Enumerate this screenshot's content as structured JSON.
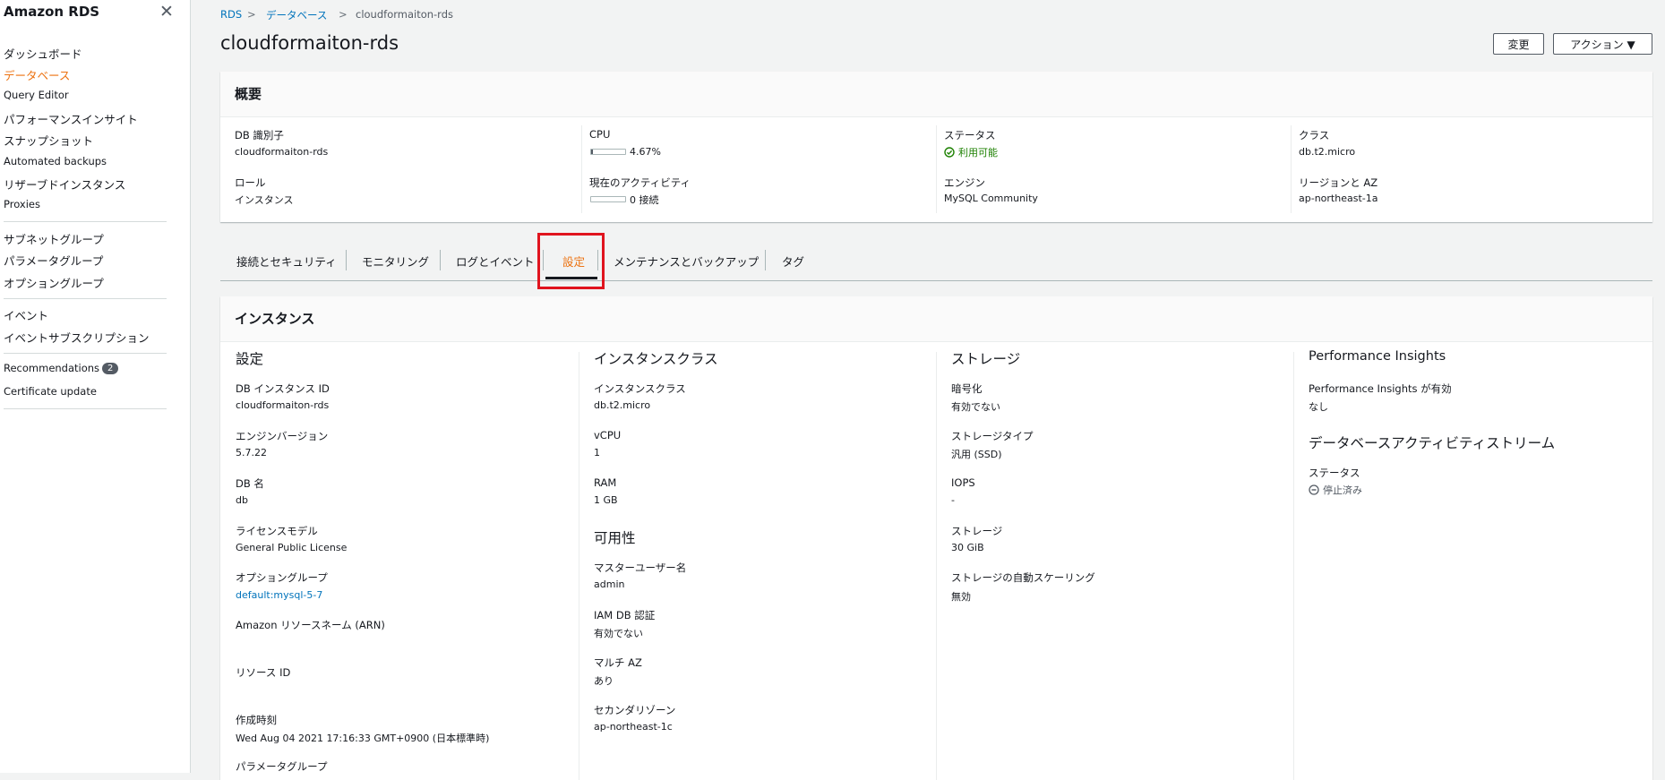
{
  "sidebar": {
    "title": "Amazon RDS",
    "items": [
      {
        "label": "ダッシュボード"
      },
      {
        "label": "データベース"
      },
      {
        "label": "Query Editor"
      },
      {
        "label": "パフォーマンスインサイト"
      },
      {
        "label": "スナップショット"
      },
      {
        "label": "Automated backups"
      },
      {
        "label": "リザーブドインスタンス"
      },
      {
        "label": "Proxies"
      },
      {
        "label": "サブネットグループ"
      },
      {
        "label": "パラメータグループ"
      },
      {
        "label": "オプショングループ"
      },
      {
        "label": "イベント"
      },
      {
        "label": "イベントサブスクリプション"
      },
      {
        "label": "Recommendations",
        "badge": "2"
      },
      {
        "label": "Certificate update"
      }
    ]
  },
  "breadcrumb": [
    "RDS",
    "データベース",
    "cloudformaiton-rds"
  ],
  "header": {
    "title": "cloudformaiton-rds",
    "modify_button": "変更",
    "actions_button": "アクション ▼"
  },
  "summary": {
    "title": "概要",
    "db_id_label": "DB 識別子",
    "db_id": "cloudformaiton-rds",
    "cpu_label": "CPU",
    "cpu_value": "4.67%",
    "cpu_fraction": 0.0467,
    "status_label": "ステータス",
    "status": "利用可能",
    "class_label": "クラス",
    "class": "db.t2.micro",
    "role_label": "ロール",
    "role": "インスタンス",
    "activity_label": "現在のアクティビティ",
    "activity": "0 接続",
    "activity_fraction": 0,
    "engine_label": "エンジン",
    "engine": "MySQL Community",
    "region_label": "リージョンと AZ",
    "region": "ap-northeast-1a"
  },
  "tabs": [
    {
      "label": "接続とセキュリティ"
    },
    {
      "label": "モニタリング"
    },
    {
      "label": "ログとイベント"
    },
    {
      "label": "設定"
    },
    {
      "label": "メンテナンスとバックアップ"
    },
    {
      "label": "タグ"
    }
  ],
  "config": {
    "title": "インスタンス",
    "col1": {
      "title": "設定",
      "fields": [
        {
          "label": "DB インスタンス ID",
          "value": "cloudformaiton-rds"
        },
        {
          "label": "エンジンバージョン",
          "value": "5.7.22"
        },
        {
          "label": "DB 名",
          "value": "db"
        },
        {
          "label": "ライセンスモデル",
          "value": "General Public License"
        },
        {
          "label": "オプショングループ",
          "value": "default:mysql-5-7"
        },
        {
          "label": "Amazon リソースネーム (ARN)",
          "value": ""
        },
        {
          "label": "リソース ID",
          "value": ""
        },
        {
          "label": "作成時刻",
          "value": "Wed Aug 04 2021 17:16:33 GMT+0900 (日本標準時)"
        },
        {
          "label": "パラメータグループ",
          "value": ""
        }
      ]
    },
    "col2": {
      "title": "インスタンスクラス",
      "fields": [
        {
          "label": "インスタンスクラス",
          "value": "db.t2.micro"
        },
        {
          "label": "vCPU",
          "value": "1"
        },
        {
          "label": "RAM",
          "value": "1 GB"
        }
      ],
      "availability_title": "可用性",
      "availability": [
        {
          "label": "マスターユーザー名",
          "value": "admin"
        },
        {
          "label": "IAM DB 認証",
          "value": "有効でない"
        },
        {
          "label": "マルチ AZ",
          "value": "あり"
        },
        {
          "label": "セカンダリゾーン",
          "value": "ap-northeast-1c"
        }
      ]
    },
    "col3": {
      "title": "ストレージ",
      "fields": [
        {
          "label": "暗号化",
          "value": "有効でない"
        },
        {
          "label": "ストレージタイプ",
          "value": "汎用 (SSD)"
        },
        {
          "label": "IOPS",
          "value": "-"
        },
        {
          "label": "ストレージ",
          "value": "30 GiB"
        },
        {
          "label": "ストレージの自動スケーリング",
          "value": "無効"
        }
      ]
    },
    "col4": {
      "title": "Performance Insights",
      "pi_label": "Performance Insights が有効",
      "pi_value": "なし",
      "stream_title": "データベースアクティビティストリーム",
      "stream_status_label": "ステータス",
      "stream_status": "停止済み"
    }
  },
  "colors": {
    "accent": "#ec7211",
    "link": "#0073bb",
    "success": "#1d8102",
    "highlight_box": "#e0141e"
  }
}
